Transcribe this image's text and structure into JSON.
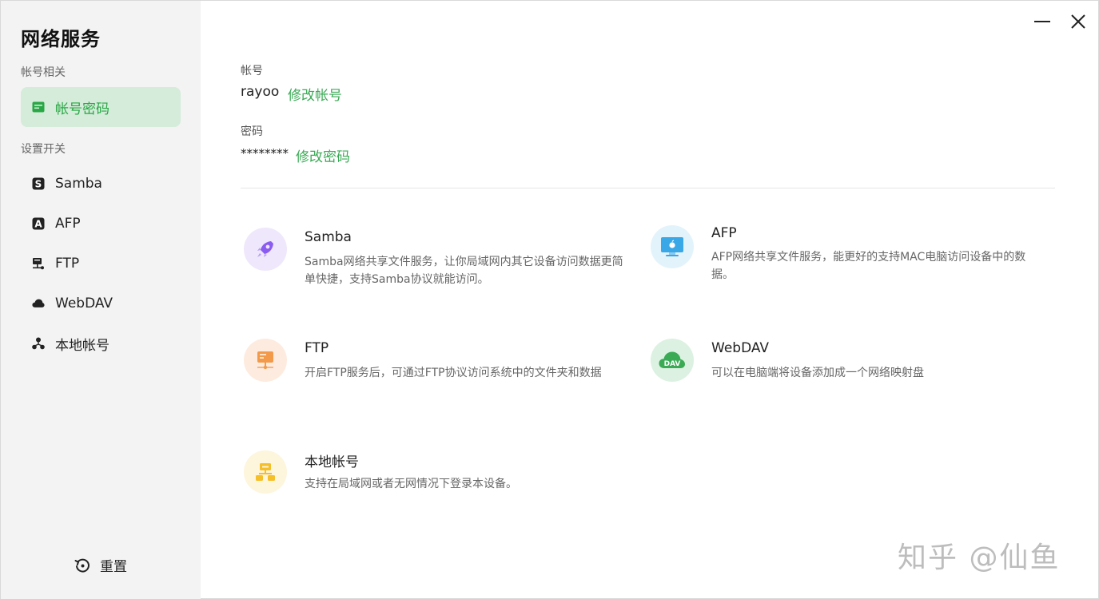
{
  "sidebar": {
    "title": "网络服务",
    "group_account": "帐号相关",
    "group_settings": "设置开关",
    "items": [
      {
        "label": "帐号密码",
        "icon": "account-card-icon"
      },
      {
        "label": "Samba",
        "icon": "samba-icon"
      },
      {
        "label": "AFP",
        "icon": "afp-icon"
      },
      {
        "label": "FTP",
        "icon": "ftp-icon"
      },
      {
        "label": "WebDAV",
        "icon": "cloud-icon"
      },
      {
        "label": "本地帐号",
        "icon": "local-account-icon"
      }
    ],
    "reset_label": "重置"
  },
  "account": {
    "username_label": "帐号",
    "username": "rayoo",
    "change_username": "修改帐号",
    "password_label": "密码",
    "password": "********",
    "change_password": "修改密码"
  },
  "services": [
    {
      "title": "Samba",
      "desc": "Samba网络共享文件服务，让你局域网内其它设备访问数据更简单快捷，支持Samba协议就能访问。",
      "icon": "rocket-icon"
    },
    {
      "title": "AFP",
      "desc": "AFP网络共享文件服务，能更好的支持MAC电脑访问设备中的数据。",
      "icon": "apple-monitor-icon"
    },
    {
      "title": "FTP",
      "desc": "开启FTP服务后，可通过FTP协议访问系统中的文件夹和数据",
      "icon": "ftp-server-icon"
    },
    {
      "title": "WebDAV",
      "desc": "可以在电脑端将设备添加成一个网络映射盘",
      "icon": "dav-cloud-icon",
      "icon_text": "DAV"
    },
    {
      "title": "本地帐号",
      "desc": "支持在局域网或者无网情况下登录本设备。",
      "icon": "local-network-icon"
    }
  ],
  "watermark": "知乎 @仙鱼",
  "colors": {
    "accent": "#3aaa55",
    "active_bg": "#d4ecd9",
    "sidebar_bg": "#f3f3f3"
  }
}
